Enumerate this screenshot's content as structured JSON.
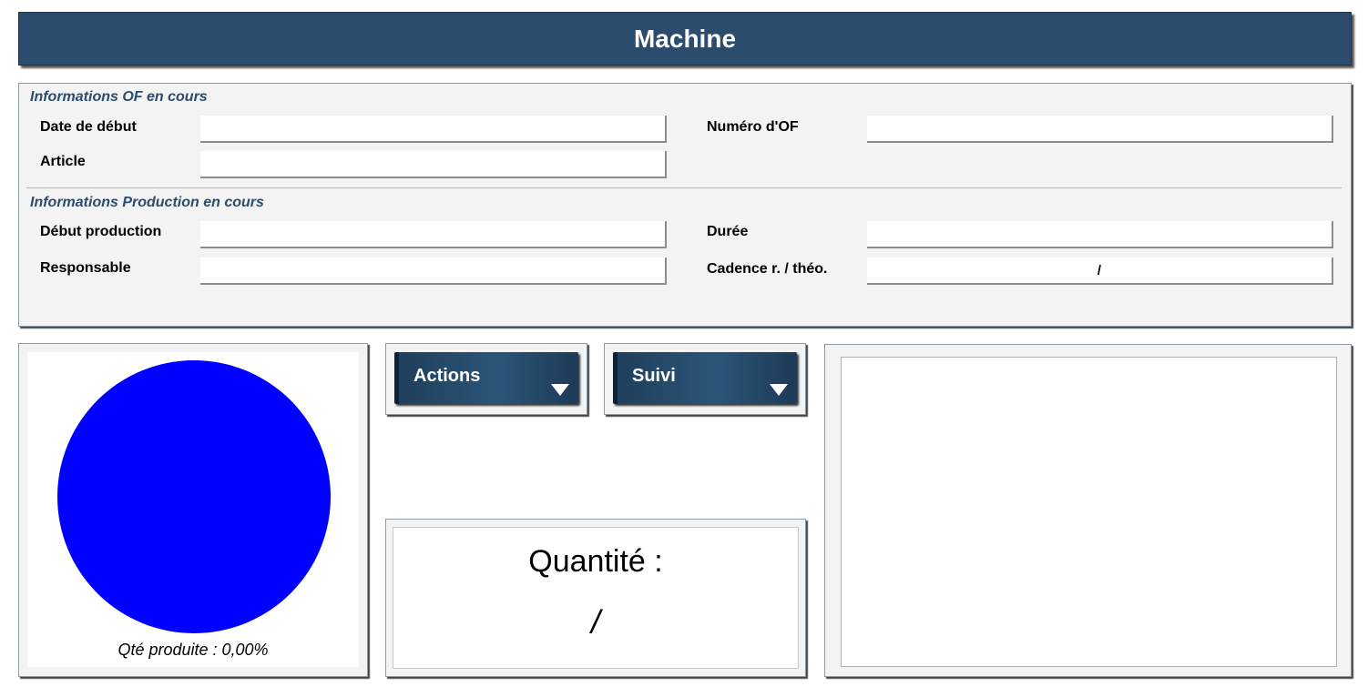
{
  "header": {
    "title": "Machine"
  },
  "of_section": {
    "title": "Informations OF en cours",
    "date_debut": {
      "label": "Date de début",
      "value": ""
    },
    "numero_of": {
      "label": "Numéro d'OF",
      "value": ""
    },
    "article": {
      "label": "Article",
      "value": ""
    }
  },
  "production_section": {
    "title": "Informations Production en cours",
    "debut_production": {
      "label": "Début production",
      "value": ""
    },
    "duree": {
      "label": "Durée",
      "value": ""
    },
    "responsable": {
      "label": "Responsable",
      "value": ""
    },
    "cadence": {
      "label": "Cadence r. / théo.",
      "value": "/"
    }
  },
  "progress": {
    "caption": "Qté produite : 0,00%",
    "percent": 0,
    "pie_color": "#0000ff"
  },
  "buttons": {
    "actions": {
      "label": "Actions",
      "icon": "caret-down-icon"
    },
    "suivi": {
      "label": "Suivi",
      "icon": "caret-down-icon"
    }
  },
  "quantity": {
    "title": "Quantité :",
    "value": "/"
  }
}
